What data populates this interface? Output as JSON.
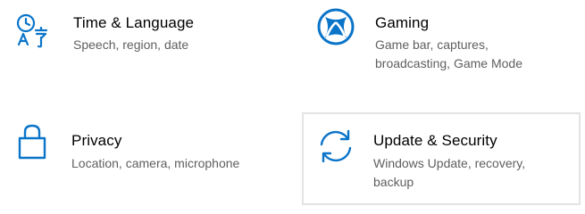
{
  "accent_color": "#0a74c9",
  "tiles": [
    {
      "icon": "time-language-icon",
      "title": "Time & Language",
      "description": "Speech, region, date"
    },
    {
      "icon": "xbox-icon",
      "title": "Gaming",
      "description": "Game bar, captures, broadcasting, Game Mode"
    },
    {
      "icon": "lock-icon",
      "title": "Privacy",
      "description": "Location, camera, microphone"
    },
    {
      "icon": "sync-icon",
      "title": "Update & Security",
      "description": "Windows Update, recovery, backup",
      "hovered": true
    }
  ]
}
